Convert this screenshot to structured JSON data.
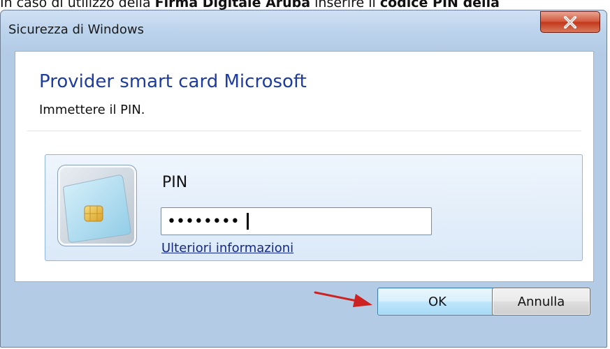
{
  "top_caption": {
    "prefix": "In caso di utilizzo della ",
    "bold1": "Firma Digitale Aruba",
    "middle": " inserire il ",
    "bold2": "codice PIN della"
  },
  "window": {
    "title": "Sicurezza di Windows"
  },
  "dialog": {
    "heading": "Provider smart card Microsoft",
    "subtext": "Immettere il PIN."
  },
  "credential": {
    "pin_label": "PIN",
    "pin_value": "••••••••",
    "more_info_link": "Ulteriori informazioni"
  },
  "buttons": {
    "ok_label": "OK",
    "cancel_label": "Annulla"
  },
  "icons": {
    "close": "close-icon",
    "smart_card": "smart-card-icon",
    "arrow": "red-arrow-icon"
  },
  "colors": {
    "heading": "#1e3ca0",
    "link": "#14288a",
    "close_button": "#c2371b",
    "arrow": "#cc2222",
    "ok_border": "#3c7fb1"
  }
}
